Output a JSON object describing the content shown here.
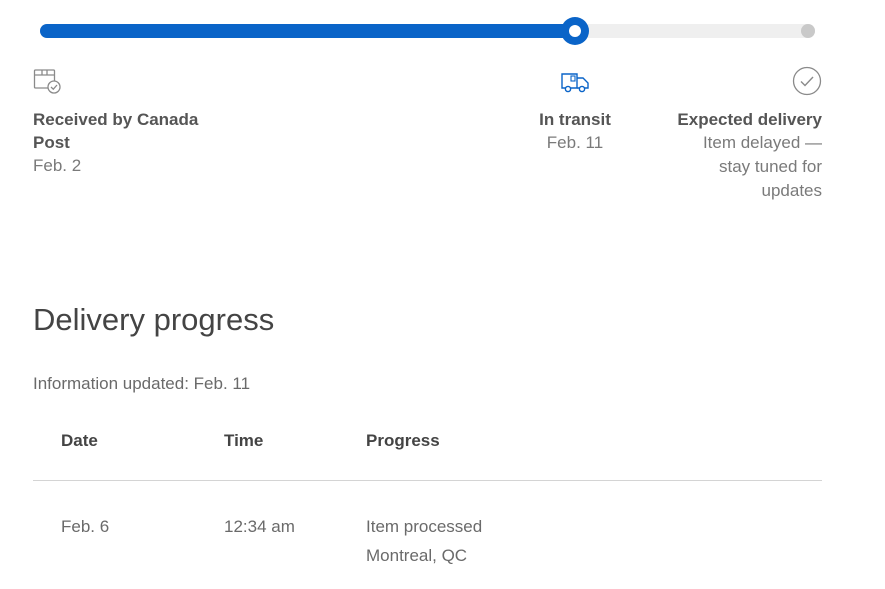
{
  "tracker": {
    "progress_fraction": 0.69,
    "accent_color": "#0a64c8",
    "steps": [
      {
        "icon": "package-check-icon",
        "label": "Received by Canada Post",
        "sub": "Feb. 2"
      },
      {
        "icon": "truck-icon",
        "label": "In transit",
        "sub": "Feb. 11"
      },
      {
        "icon": "check-circle-icon",
        "label": "Expected delivery",
        "sub": "Item delayed — stay tuned for updates"
      }
    ]
  },
  "progress": {
    "title": "Delivery progress",
    "updated": "Information updated: Feb. 11",
    "columns": [
      "Date",
      "Time",
      "Progress"
    ],
    "rows": [
      {
        "date": "Feb. 6",
        "time": "12:34 am",
        "progress": "Item processed",
        "location": "Montreal, QC"
      }
    ]
  }
}
